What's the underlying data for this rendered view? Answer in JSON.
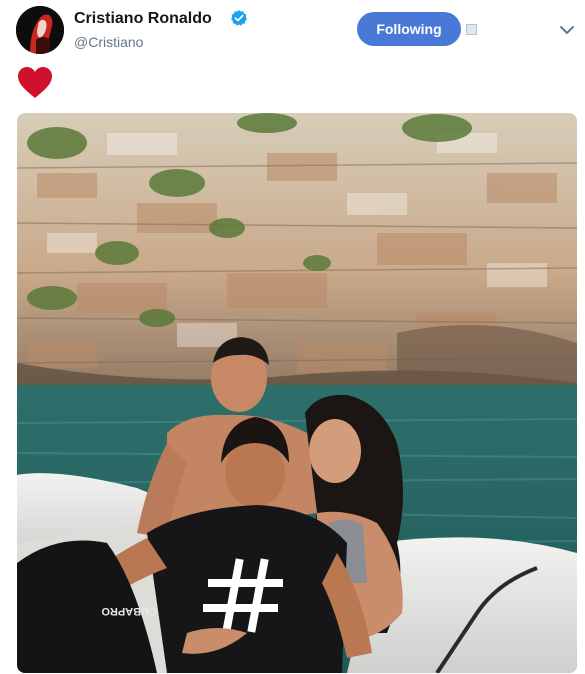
{
  "tweet": {
    "author": {
      "display_name": "Cristiano Ronaldo",
      "handle": "@Cristiano",
      "verified": true,
      "verified_icon": "verified-badge-icon",
      "avatar_icon": "avatar"
    },
    "follow_button": {
      "label": "Following"
    },
    "body": {
      "emoji": "heart",
      "emoji_icon": "heart-icon"
    },
    "media": {
      "type": "photo",
      "shirt_print": "#",
      "boat_text": "CUBAPRO"
    }
  },
  "colors": {
    "follow_button": "#4a78d6",
    "heart": "#d0112b",
    "verified": "#1da1f2",
    "name": "#14171a",
    "handle": "#657786"
  }
}
